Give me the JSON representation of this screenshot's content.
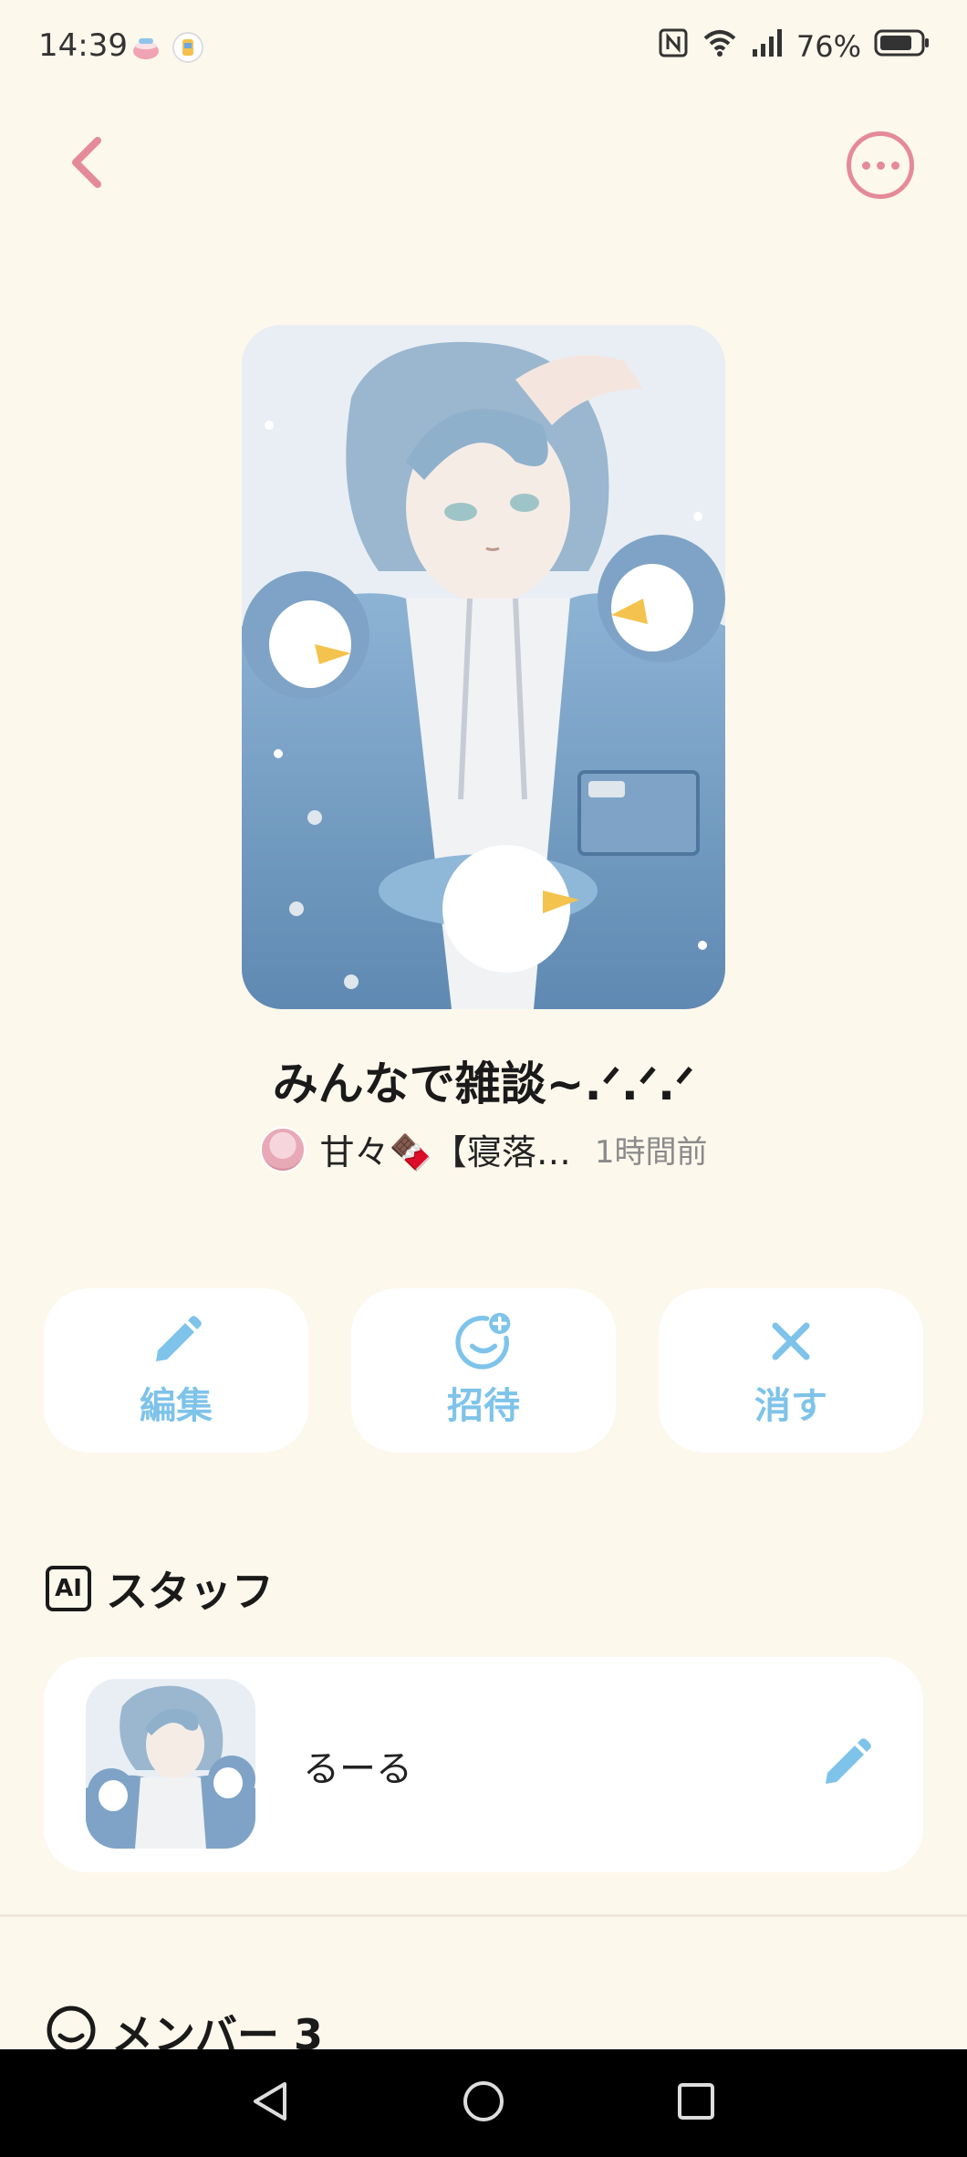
{
  "status_bar": {
    "time": "14:39",
    "battery": "76%",
    "icons": [
      "teacup-icon",
      "app-icon",
      "nfc-icon",
      "wifi-icon",
      "signal-icon",
      "battery-icon"
    ]
  },
  "header": {
    "back_icon": "chevron-left-icon",
    "more_icon": "ellipsis-circle-icon",
    "accent_color": "#e58a98"
  },
  "room": {
    "title": "みんなで雑談~.ᐟ.ᐟ.ᐟ",
    "owner_name": "甘々🍫【寝落…",
    "posted": "1時間前"
  },
  "actions": [
    {
      "label": "編集",
      "icon": "pencil-icon"
    },
    {
      "label": "招待",
      "icon": "add-face-icon"
    },
    {
      "label": "消す",
      "icon": "close-icon"
    }
  ],
  "action_color": "#7ec3ea",
  "staff": {
    "section_title": "スタッフ",
    "badge": "AI",
    "items": [
      {
        "name": "るーる",
        "icon": "pencil-icon"
      }
    ]
  },
  "members": {
    "section_title": "メンバー 3"
  }
}
